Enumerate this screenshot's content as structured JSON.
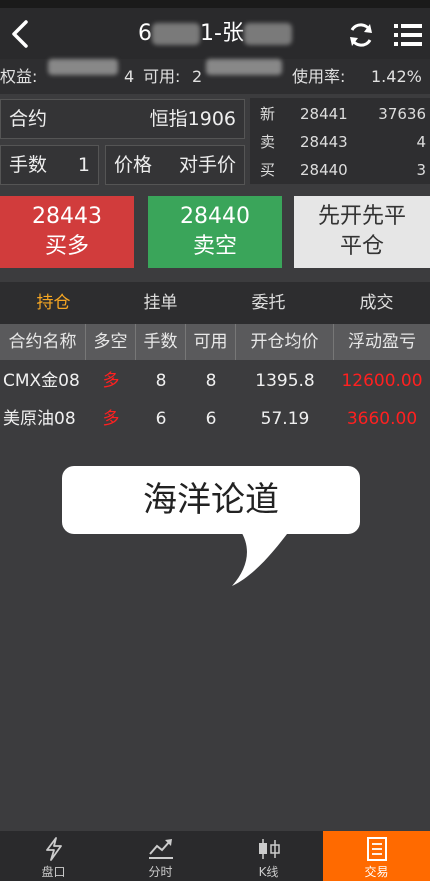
{
  "header": {
    "title_prefix": "6",
    "title_suffix": "1-张"
  },
  "account": {
    "equity_label": "权益:",
    "equity_tail": "4",
    "available_label": "可用:",
    "available_head": "2",
    "usage_label": "使用率:",
    "usage_value": "1.42%"
  },
  "order": {
    "contract_label": "合约",
    "contract_value": "恒指1906",
    "qty_label": "手数",
    "qty_value": "1",
    "price_label": "价格",
    "price_value": "对手价"
  },
  "quote": [
    {
      "key": "新",
      "price": "28441",
      "vol": "37636"
    },
    {
      "key": "卖",
      "price": "28443",
      "vol": "4"
    },
    {
      "key": "买",
      "price": "28440",
      "vol": "3"
    }
  ],
  "buttons": {
    "buy_price": "28443",
    "buy_label": "买多",
    "sell_price": "28440",
    "sell_label": "卖空",
    "close_line1": "先开先平",
    "close_line2": "平仓"
  },
  "tabs": [
    "持仓",
    "挂单",
    "委托",
    "成交"
  ],
  "table": {
    "headers": [
      "合约名称",
      "多空",
      "手数",
      "可用",
      "开仓均价",
      "浮动盈亏"
    ],
    "rows": [
      [
        "CMX金08",
        "多",
        "8",
        "8",
        "1395.8",
        "12600.00"
      ],
      [
        "美原油08",
        "多",
        "6",
        "6",
        "57.19",
        "3660.00"
      ]
    ]
  },
  "watermark": "海洋论道",
  "nav": [
    "盘口",
    "分时",
    "K线",
    "交易"
  ],
  "colors": {
    "buy": "#d13c3c",
    "sell": "#3aa55a",
    "active_tab": "#f5a623",
    "nav_active": "#ff6a00",
    "loss": "#ff2020"
  }
}
